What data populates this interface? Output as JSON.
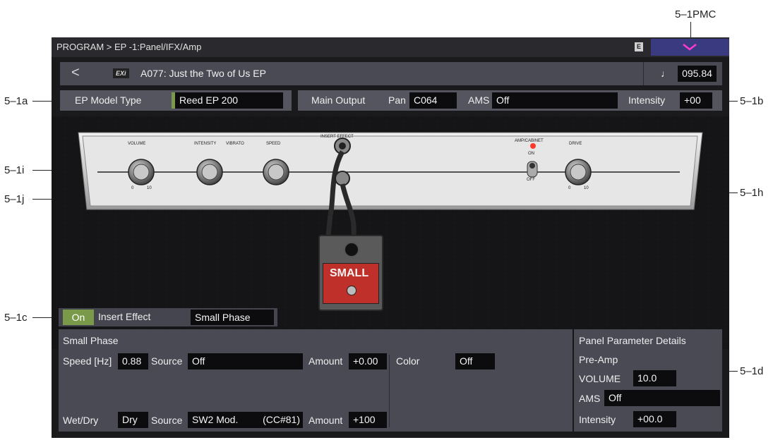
{
  "callouts": {
    "pmc": "5–1PMC",
    "a": "5–1a",
    "b": "5–1b",
    "i": "5–1i",
    "j": "5–1j",
    "h": "5–1h",
    "c": "5–1c",
    "d": "5–1d"
  },
  "titlebar": {
    "breadcrumb": "PROGRAM > EP -1:Panel/IFX/Amp",
    "badge": "E"
  },
  "program": {
    "back_glyph": "<",
    "engine_badge": "EXi",
    "name": "A077: Just the Two of Us EP",
    "note_glyph": "♩",
    "tempo": "095.84"
  },
  "model_row": {
    "label": "EP Model Type",
    "value": "Reed EP 200"
  },
  "output_row": {
    "label": "Main Output",
    "pan_label": "Pan",
    "pan_value": "C064",
    "ams_label": "AMS",
    "ams_value": "Off",
    "intensity_label": "Intensity",
    "intensity_value": "+00"
  },
  "amp_panel": {
    "knob_labels": [
      "VOLUME",
      "INTENSITY",
      "VIBRATO",
      "SPEED",
      "INSERT EFFECT",
      "AMP/CABINET",
      "DRIVE"
    ],
    "switch_on": "ON",
    "switch_off": "OFF",
    "scale_min": "0",
    "scale_max": "10",
    "pedal_label": "SMALL"
  },
  "insert_effect": {
    "on_label": "On",
    "label": "Insert Effect",
    "value": "Small Phase"
  },
  "small_phase": {
    "title": "Small Phase",
    "speed_label": "Speed [Hz]",
    "speed_value": "0.88",
    "source1_label": "Source",
    "source1_value": "Off",
    "amount1_label": "Amount",
    "amount1_value": "+0.00",
    "color_label": "Color",
    "color_value": "Off",
    "wetdry_label": "Wet/Dry",
    "wetdry_value": "Dry",
    "source2_label": "Source",
    "source2_value": "SW2 Mod.",
    "source2_cc": "(CC#81)",
    "amount2_label": "Amount",
    "amount2_value": "+100"
  },
  "details": {
    "title": "Panel Parameter Details",
    "section": "Pre-Amp",
    "volume_label": "VOLUME",
    "volume_value": "10.0",
    "ams_label": "AMS",
    "ams_value": "Off",
    "intensity_label": "Intensity",
    "intensity_value": "+00.0"
  },
  "colors": {
    "accent_green": "#7a9a4a",
    "pmc_blue": "#3a3a80",
    "pedal_red": "#c0302a",
    "led_red": "#ff3a2a"
  },
  "icons": {
    "back": "chevron-left-icon",
    "pmc": "chevron-down-icon",
    "note": "quarter-note-icon"
  }
}
